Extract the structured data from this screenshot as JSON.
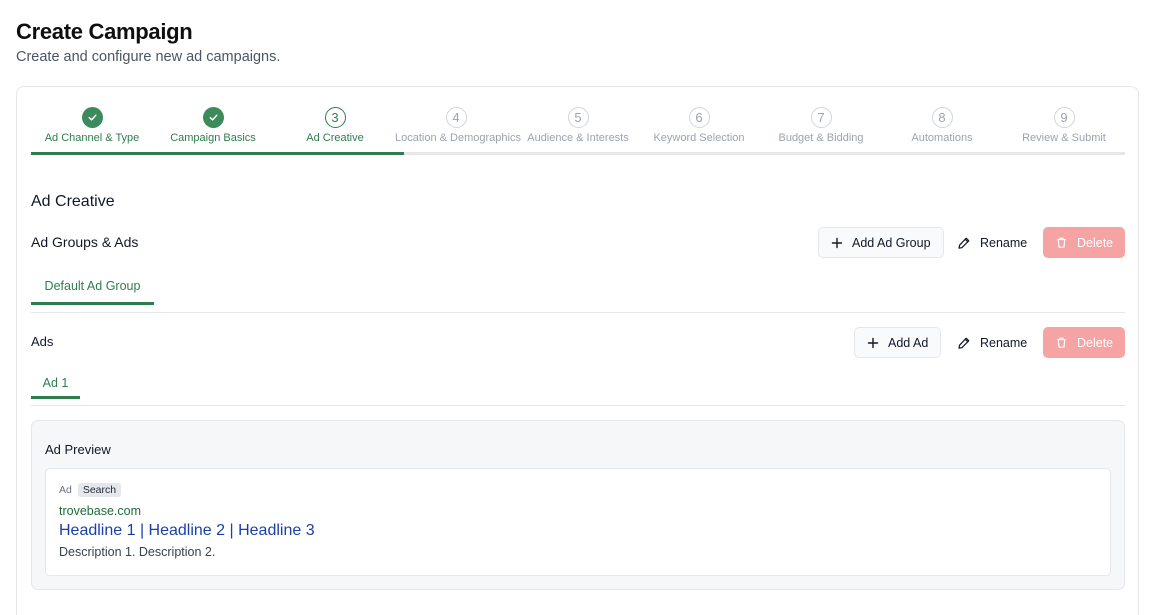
{
  "page": {
    "title": "Create Campaign",
    "subtitle": "Create and configure new ad campaigns."
  },
  "stepper": {
    "current_step": 3,
    "steps": [
      {
        "number": "1",
        "label": "Ad Channel & Type",
        "status": "done"
      },
      {
        "number": "2",
        "label": "Campaign Basics",
        "status": "done"
      },
      {
        "number": "3",
        "label": "Ad Creative",
        "status": "current"
      },
      {
        "number": "4",
        "label": "Location & Demographics",
        "status": "future"
      },
      {
        "number": "5",
        "label": "Audience & Interests",
        "status": "future"
      },
      {
        "number": "6",
        "label": "Keyword Selection",
        "status": "future"
      },
      {
        "number": "7",
        "label": "Budget & Bidding",
        "status": "future"
      },
      {
        "number": "8",
        "label": "Automations",
        "status": "future"
      },
      {
        "number": "9",
        "label": "Review & Submit",
        "status": "future"
      }
    ]
  },
  "section": {
    "title": "Ad Creative"
  },
  "ad_groups": {
    "title": "Ad Groups & Ads",
    "add_label": "Add Ad Group",
    "rename_label": "Rename",
    "delete_label": "Delete",
    "tabs": [
      {
        "label": "Default Ad Group",
        "active": true
      }
    ]
  },
  "ads": {
    "title": "Ads",
    "add_label": "Add Ad",
    "rename_label": "Rename",
    "delete_label": "Delete",
    "tabs": [
      {
        "label": "Ad 1",
        "active": true
      }
    ]
  },
  "preview": {
    "title": "Ad Preview",
    "ad_label": "Ad",
    "ad_type": "Search",
    "url": "trovebase.com",
    "headline": "Headline 1 | Headline 2 | Headline 3",
    "description": "Description 1. Description 2."
  },
  "colors": {
    "accent": "#2e7d4f",
    "danger_disabled": "#f5a3a3",
    "headline_link": "#1a3fa8"
  },
  "icons": {
    "done_step": "check-icon",
    "add": "plus-icon",
    "rename": "pencil-icon",
    "delete": "trash-icon"
  }
}
